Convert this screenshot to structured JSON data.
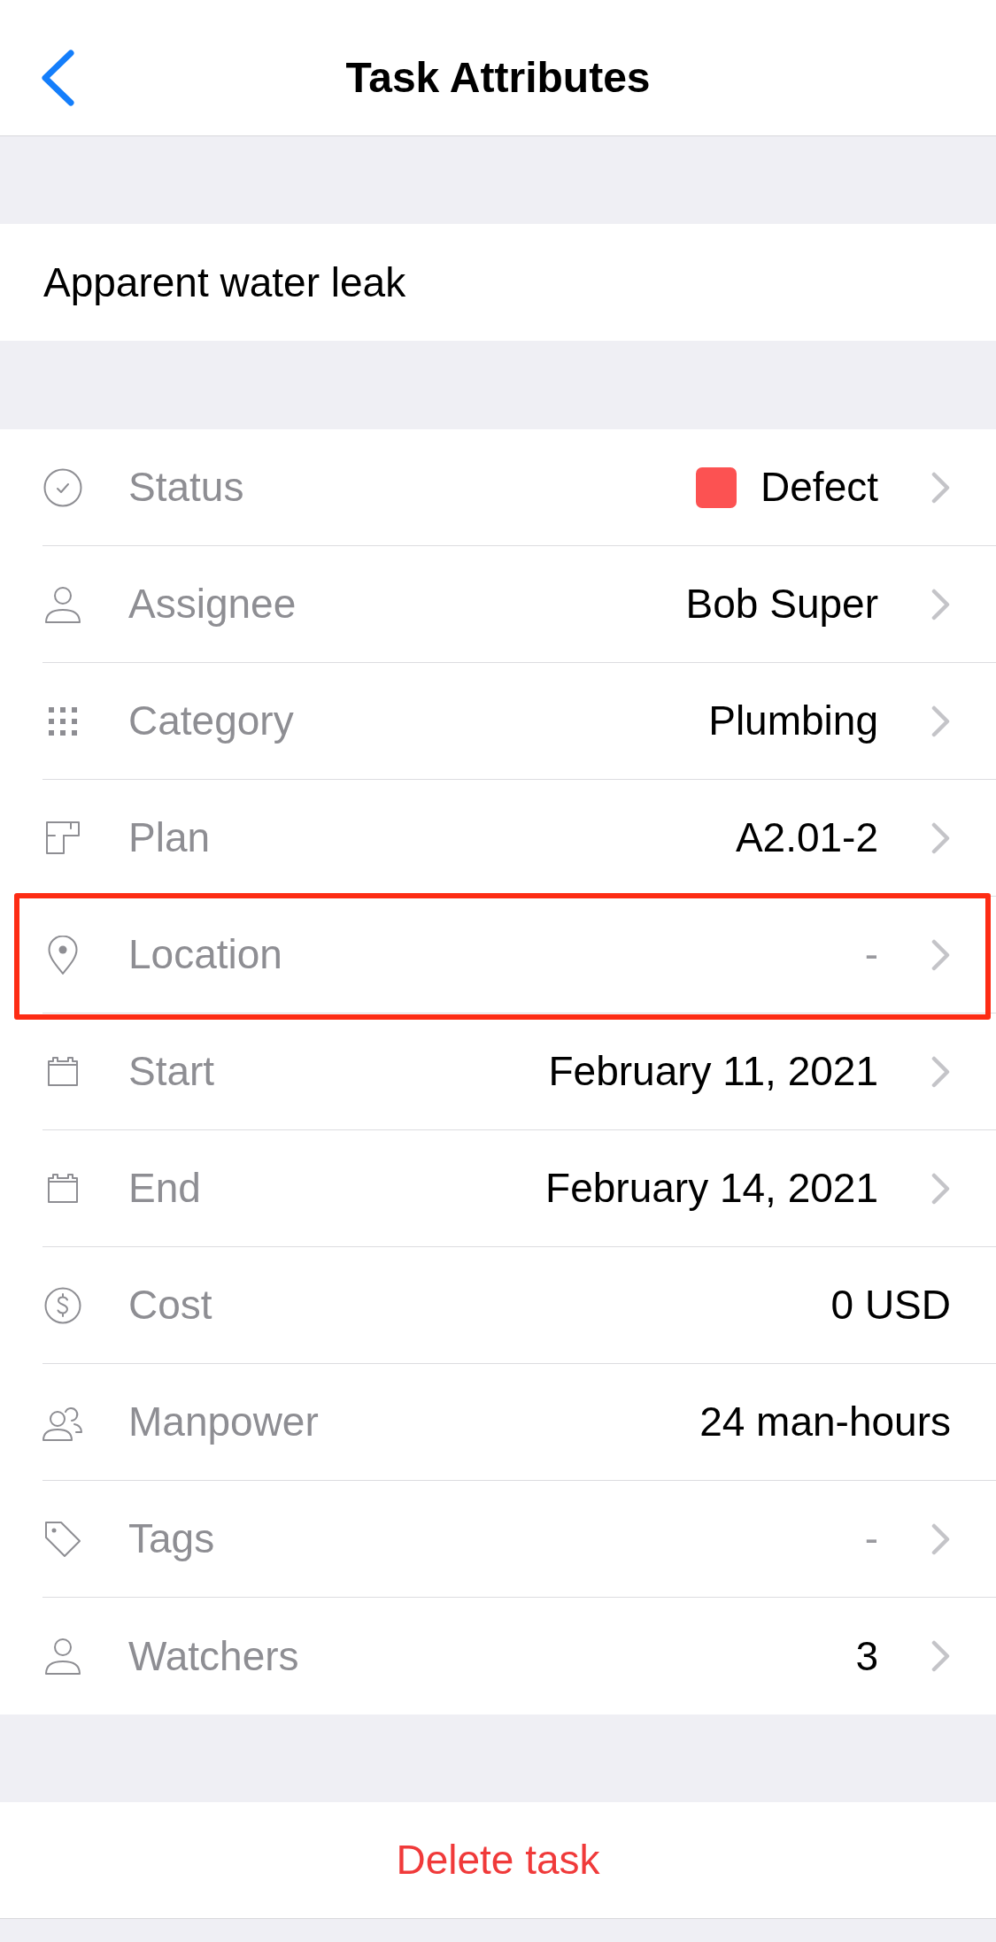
{
  "nav_bar": {
    "title": "Task Attributes"
  },
  "task": {
    "title": "Apparent water leak"
  },
  "attributes": [
    {
      "label": "Status",
      "value": "Defect",
      "color": "#fc5252",
      "empty": false,
      "disclosure": true,
      "highlighted": false
    },
    {
      "label": "Assignee",
      "value": "Bob Super",
      "empty": false,
      "disclosure": true,
      "highlighted": false
    },
    {
      "label": "Category",
      "value": "Plumbing",
      "empty": false,
      "disclosure": true,
      "highlighted": false
    },
    {
      "label": "Plan",
      "value": "A2.01-2",
      "empty": false,
      "disclosure": true,
      "highlighted": false
    },
    {
      "label": "Location",
      "value": "-",
      "empty": true,
      "disclosure": true,
      "highlighted": true
    },
    {
      "label": "Start",
      "value": "February 11, 2021",
      "empty": false,
      "disclosure": true,
      "highlighted": false
    },
    {
      "label": "End",
      "value": "February 14, 2021",
      "empty": false,
      "disclosure": true,
      "highlighted": false
    },
    {
      "label": "Cost",
      "value": "0 USD",
      "empty": false,
      "disclosure": false,
      "highlighted": false
    },
    {
      "label": "Manpower",
      "value": "24 man-hours",
      "empty": false,
      "disclosure": false,
      "highlighted": false
    },
    {
      "label": "Tags",
      "value": "-",
      "empty": true,
      "disclosure": true,
      "highlighted": false
    },
    {
      "label": "Watchers",
      "value": "3",
      "empty": false,
      "disclosure": true,
      "highlighted": false
    }
  ],
  "delete_button": {
    "label": "Delete task"
  }
}
